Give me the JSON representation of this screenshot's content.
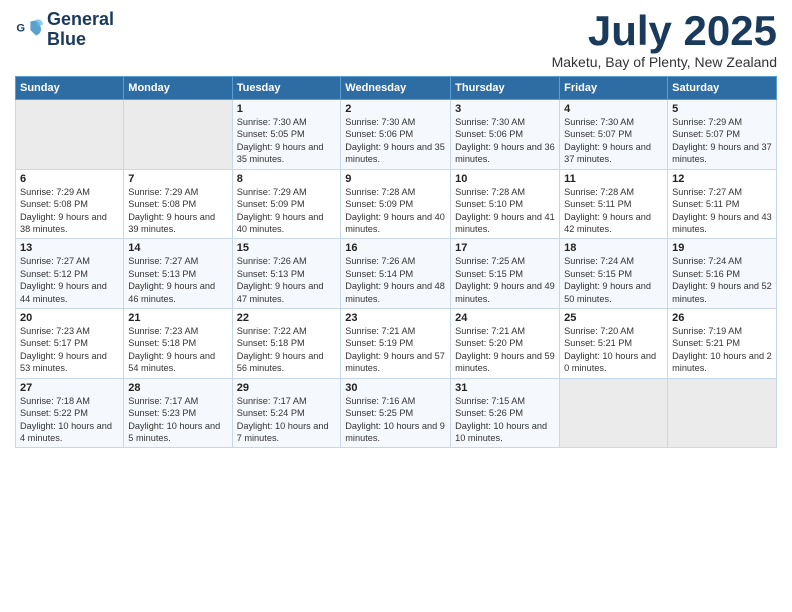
{
  "header": {
    "logo_line1": "General",
    "logo_line2": "Blue",
    "title": "July 2025",
    "location": "Maketu, Bay of Plenty, New Zealand"
  },
  "weekdays": [
    "Sunday",
    "Monday",
    "Tuesday",
    "Wednesday",
    "Thursday",
    "Friday",
    "Saturday"
  ],
  "weeks": [
    [
      {
        "num": "",
        "empty": true
      },
      {
        "num": "",
        "empty": true
      },
      {
        "num": "1",
        "sunrise": "Sunrise: 7:30 AM",
        "sunset": "Sunset: 5:05 PM",
        "daylight": "Daylight: 9 hours and 35 minutes."
      },
      {
        "num": "2",
        "sunrise": "Sunrise: 7:30 AM",
        "sunset": "Sunset: 5:06 PM",
        "daylight": "Daylight: 9 hours and 35 minutes."
      },
      {
        "num": "3",
        "sunrise": "Sunrise: 7:30 AM",
        "sunset": "Sunset: 5:06 PM",
        "daylight": "Daylight: 9 hours and 36 minutes."
      },
      {
        "num": "4",
        "sunrise": "Sunrise: 7:30 AM",
        "sunset": "Sunset: 5:07 PM",
        "daylight": "Daylight: 9 hours and 37 minutes."
      },
      {
        "num": "5",
        "sunrise": "Sunrise: 7:29 AM",
        "sunset": "Sunset: 5:07 PM",
        "daylight": "Daylight: 9 hours and 37 minutes."
      }
    ],
    [
      {
        "num": "6",
        "sunrise": "Sunrise: 7:29 AM",
        "sunset": "Sunset: 5:08 PM",
        "daylight": "Daylight: 9 hours and 38 minutes."
      },
      {
        "num": "7",
        "sunrise": "Sunrise: 7:29 AM",
        "sunset": "Sunset: 5:08 PM",
        "daylight": "Daylight: 9 hours and 39 minutes."
      },
      {
        "num": "8",
        "sunrise": "Sunrise: 7:29 AM",
        "sunset": "Sunset: 5:09 PM",
        "daylight": "Daylight: 9 hours and 40 minutes."
      },
      {
        "num": "9",
        "sunrise": "Sunrise: 7:28 AM",
        "sunset": "Sunset: 5:09 PM",
        "daylight": "Daylight: 9 hours and 40 minutes."
      },
      {
        "num": "10",
        "sunrise": "Sunrise: 7:28 AM",
        "sunset": "Sunset: 5:10 PM",
        "daylight": "Daylight: 9 hours and 41 minutes."
      },
      {
        "num": "11",
        "sunrise": "Sunrise: 7:28 AM",
        "sunset": "Sunset: 5:11 PM",
        "daylight": "Daylight: 9 hours and 42 minutes."
      },
      {
        "num": "12",
        "sunrise": "Sunrise: 7:27 AM",
        "sunset": "Sunset: 5:11 PM",
        "daylight": "Daylight: 9 hours and 43 minutes."
      }
    ],
    [
      {
        "num": "13",
        "sunrise": "Sunrise: 7:27 AM",
        "sunset": "Sunset: 5:12 PM",
        "daylight": "Daylight: 9 hours and 44 minutes."
      },
      {
        "num": "14",
        "sunrise": "Sunrise: 7:27 AM",
        "sunset": "Sunset: 5:13 PM",
        "daylight": "Daylight: 9 hours and 46 minutes."
      },
      {
        "num": "15",
        "sunrise": "Sunrise: 7:26 AM",
        "sunset": "Sunset: 5:13 PM",
        "daylight": "Daylight: 9 hours and 47 minutes."
      },
      {
        "num": "16",
        "sunrise": "Sunrise: 7:26 AM",
        "sunset": "Sunset: 5:14 PM",
        "daylight": "Daylight: 9 hours and 48 minutes."
      },
      {
        "num": "17",
        "sunrise": "Sunrise: 7:25 AM",
        "sunset": "Sunset: 5:15 PM",
        "daylight": "Daylight: 9 hours and 49 minutes."
      },
      {
        "num": "18",
        "sunrise": "Sunrise: 7:24 AM",
        "sunset": "Sunset: 5:15 PM",
        "daylight": "Daylight: 9 hours and 50 minutes."
      },
      {
        "num": "19",
        "sunrise": "Sunrise: 7:24 AM",
        "sunset": "Sunset: 5:16 PM",
        "daylight": "Daylight: 9 hours and 52 minutes."
      }
    ],
    [
      {
        "num": "20",
        "sunrise": "Sunrise: 7:23 AM",
        "sunset": "Sunset: 5:17 PM",
        "daylight": "Daylight: 9 hours and 53 minutes."
      },
      {
        "num": "21",
        "sunrise": "Sunrise: 7:23 AM",
        "sunset": "Sunset: 5:18 PM",
        "daylight": "Daylight: 9 hours and 54 minutes."
      },
      {
        "num": "22",
        "sunrise": "Sunrise: 7:22 AM",
        "sunset": "Sunset: 5:18 PM",
        "daylight": "Daylight: 9 hours and 56 minutes."
      },
      {
        "num": "23",
        "sunrise": "Sunrise: 7:21 AM",
        "sunset": "Sunset: 5:19 PM",
        "daylight": "Daylight: 9 hours and 57 minutes."
      },
      {
        "num": "24",
        "sunrise": "Sunrise: 7:21 AM",
        "sunset": "Sunset: 5:20 PM",
        "daylight": "Daylight: 9 hours and 59 minutes."
      },
      {
        "num": "25",
        "sunrise": "Sunrise: 7:20 AM",
        "sunset": "Sunset: 5:21 PM",
        "daylight": "Daylight: 10 hours and 0 minutes."
      },
      {
        "num": "26",
        "sunrise": "Sunrise: 7:19 AM",
        "sunset": "Sunset: 5:21 PM",
        "daylight": "Daylight: 10 hours and 2 minutes."
      }
    ],
    [
      {
        "num": "27",
        "sunrise": "Sunrise: 7:18 AM",
        "sunset": "Sunset: 5:22 PM",
        "daylight": "Daylight: 10 hours and 4 minutes."
      },
      {
        "num": "28",
        "sunrise": "Sunrise: 7:17 AM",
        "sunset": "Sunset: 5:23 PM",
        "daylight": "Daylight: 10 hours and 5 minutes."
      },
      {
        "num": "29",
        "sunrise": "Sunrise: 7:17 AM",
        "sunset": "Sunset: 5:24 PM",
        "daylight": "Daylight: 10 hours and 7 minutes."
      },
      {
        "num": "30",
        "sunrise": "Sunrise: 7:16 AM",
        "sunset": "Sunset: 5:25 PM",
        "daylight": "Daylight: 10 hours and 9 minutes."
      },
      {
        "num": "31",
        "sunrise": "Sunrise: 7:15 AM",
        "sunset": "Sunset: 5:26 PM",
        "daylight": "Daylight: 10 hours and 10 minutes."
      },
      {
        "num": "",
        "empty": true
      },
      {
        "num": "",
        "empty": true
      }
    ]
  ]
}
